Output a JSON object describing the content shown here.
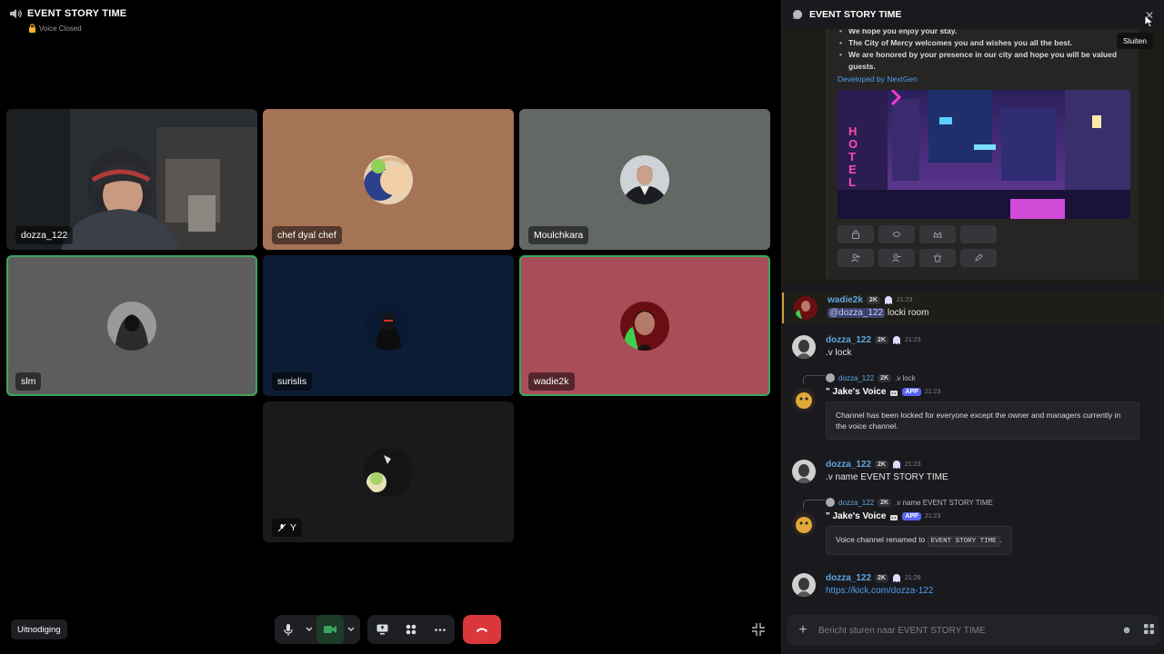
{
  "voice": {
    "channel_title": "EVENT STORY TIME",
    "status": "Voice Closed",
    "participants": [
      {
        "name": "dozza_122"
      },
      {
        "name": "chef dyal chef"
      },
      {
        "name": "Moulchkara"
      },
      {
        "name": "slm"
      },
      {
        "name": "surislis"
      },
      {
        "name": "wadie2k"
      },
      {
        "name": "Y"
      }
    ]
  },
  "controls": {
    "invite_label": "Uitnodiging"
  },
  "chat": {
    "title": "EVENT STORY TIME",
    "close_tooltip": "Sluiten",
    "embed": {
      "lines": [
        "We hope you enjoy your stay.",
        "The City of Mercy welcomes you and wishes you all the best.",
        "We are honored by your presence in our city and hope you will be valued guests."
      ],
      "developer": "Developed by NextGen",
      "image_sign": "HOTEL"
    },
    "messages": [
      {
        "author": "wadie2k",
        "badge": "2K",
        "time": "21:23",
        "mention": "@dozza_122",
        "text": " locki room"
      },
      {
        "author": "dozza_122",
        "badge": "2K",
        "time": "21:23",
        "text": ".v lock"
      },
      {
        "reply_author": "dozza_122",
        "reply_badge": "2K",
        "reply_text": ".v lock",
        "author": "\" Jake's Voice",
        "app": "APP",
        "time": "21:23",
        "box": "Channel has been locked for everyone except the owner and managers currently in the voice channel."
      },
      {
        "author": "dozza_122",
        "badge": "2K",
        "time": "21:23",
        "text": ".v name EVENT STORY TIME"
      },
      {
        "reply_author": "dozza_122",
        "reply_badge": "2K",
        "reply_text": ".v name EVENT STORY TIME",
        "author": "\" Jake's Voice",
        "app": "APP",
        "time": "21:23",
        "box_prefix": "Voice channel renamed to ",
        "box_code": "EVENT STORY TIME",
        "box_suffix": "."
      },
      {
        "author": "dozza_122",
        "badge": "2K",
        "time": "21:28",
        "link": "https://kick.com/dozza-122"
      }
    ],
    "input_placeholder": "Bericht sturen naar EVENT STORY TIME"
  },
  "colors": {
    "speaking": "#3ba55d",
    "hangup": "#da373c",
    "link": "#4c9ef0",
    "app_badge": "#5865f2"
  },
  "icons": [
    "speaker-icon",
    "lock-icon",
    "mic-icon",
    "camera-icon",
    "screenshare-icon",
    "activities-icon",
    "more-icon",
    "hangup-icon",
    "fullscreen-icon",
    "thread-icon",
    "close-icon",
    "plus-icon",
    "emoji-icon",
    "apps-icon",
    "mute-icon"
  ]
}
